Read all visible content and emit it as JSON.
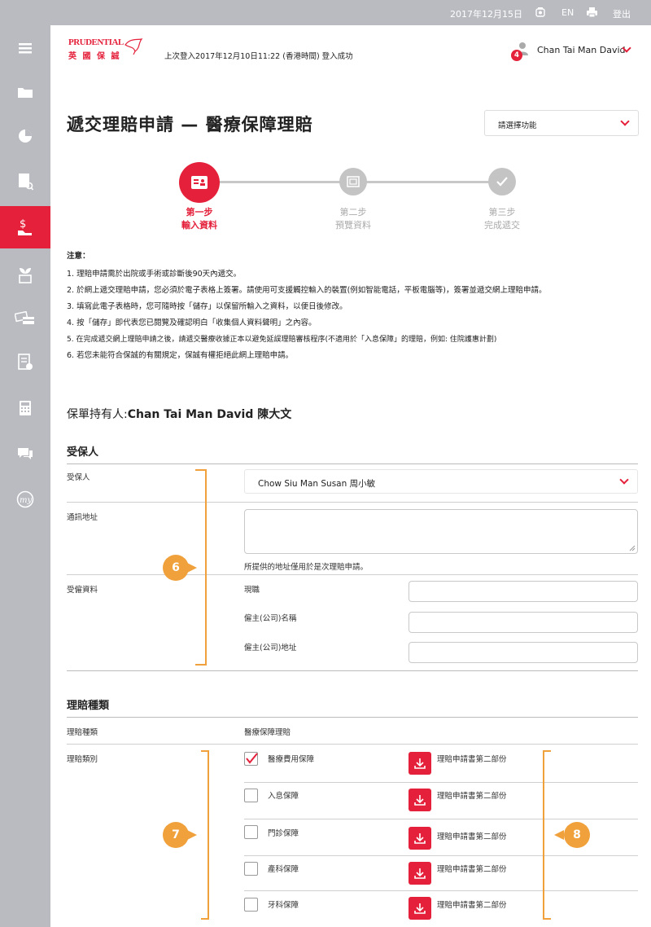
{
  "topbar": {
    "date": "2017年12月15日",
    "language": "EN",
    "logout": "登出",
    "icons": [
      "contact-icon",
      "print-icon"
    ]
  },
  "sidebar": {
    "items": [
      "menu-icon",
      "folder-icon",
      "pie-chart-icon",
      "document-search-icon",
      "claim-icon",
      "plant-icon",
      "payment-icon",
      "form-check-icon",
      "calculator-icon",
      "chat-icon",
      "my-icon"
    ],
    "active_index": 4
  },
  "header": {
    "logo_en": "PRUDENTIAL",
    "logo_zh": "英 國 保 誠",
    "last_login": "上次登入2017年12月10日11:22 (香港時間) 登入成功",
    "user_name": "Chan Tai Man David",
    "notification_count": "4"
  },
  "page": {
    "title": "遞交理賠申請 — 醫療保障理賠",
    "function_select": "請選擇功能"
  },
  "steps": [
    {
      "step": "第一步",
      "label": "輸入資料",
      "state": "active"
    },
    {
      "step": "第二步",
      "label": "預覽資料",
      "state": "inactive"
    },
    {
      "step": "第三步",
      "label": "完成遞交",
      "state": "inactive"
    }
  ],
  "notes": {
    "heading": "注意：",
    "items": [
      "1. 理賠申請需於出院或手術或診斷後90天內遞交。",
      "2. 於網上遞交理賠申請，您必須於電子表格上簽署。請使用可支援觸控輸入的裝置(例如智能電話，平板電腦等)，簽署並遞交網上理賠申請。",
      "3. 填寫此電子表格時，您可隨時按「儲存」以保留所輸入之資料，以便日後修改。",
      "4. 按「儲存」即代表您已閱覽及確認明白「收集個人資料聲明」之內容。",
      "5. 在完成遞交網上理賠申請之後，請遞交醫療收據正本以避免延誤理賠審核程序(不適用於「入息保障」的理賠，例如: 住院護惠計劃)",
      "6. 若您未能符合保誠的有關規定，保誠有權拒絕此網上理賠申請。"
    ]
  },
  "policyholder": {
    "label": "保單持有人:",
    "name": "Chan Tai Man David 陳大文"
  },
  "insured_section": {
    "title": "受保人",
    "insured_label": "受保人",
    "insured_value": "Chow Siu Man Susan 周小敏",
    "address_label": "通訊地址",
    "address_note": "所提供的地址僅用於是次理賠申請。",
    "employment_label": "受僱資料",
    "job_label": "現職",
    "employer_name_label": "僱主(公司)名稱",
    "employer_address_label": "僱主(公司)地址"
  },
  "claim_section": {
    "title": "理賠種類",
    "type_label": "理賠種類",
    "type_value": "醫療保障理賠",
    "category_label": "理賠類別",
    "categories": [
      {
        "name": "醫療費用保障",
        "checked": true,
        "form": "理賠申請書第二部份"
      },
      {
        "name": "入息保障",
        "checked": false,
        "form": "理賠申請書第二部份"
      },
      {
        "name": "門診保障",
        "checked": false,
        "form": "理賠申請書第二部份"
      },
      {
        "name": "產科保障",
        "checked": false,
        "form": "理賠申請書第二部份"
      },
      {
        "name": "牙科保障",
        "checked": false,
        "form": "理賠申請書第二部份"
      }
    ]
  },
  "callouts": [
    "6",
    "7",
    "8"
  ],
  "colors": {
    "brand_red": "#e4203a",
    "sidebar_gray": "#b9bbc1",
    "callout_orange": "#f0a13b"
  }
}
